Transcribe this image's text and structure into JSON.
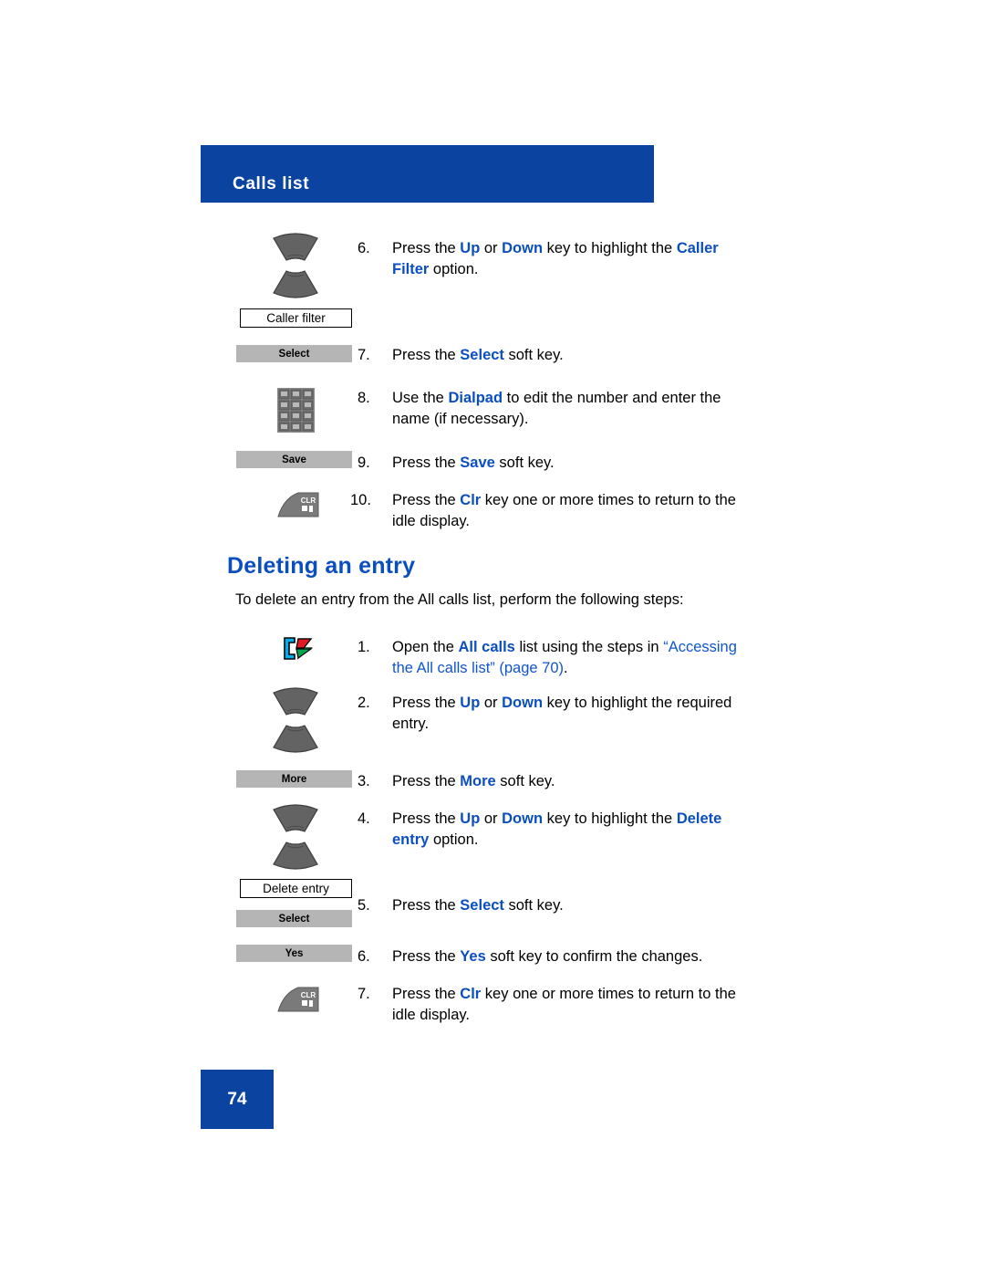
{
  "header": {
    "title": "Calls list"
  },
  "page": {
    "number": "74"
  },
  "section": {
    "heading": "Deleting an entry",
    "intro": "To delete an entry from the All calls list, perform the following steps:"
  },
  "icons": {
    "nav_keys": "up-down-navigation-keys-icon",
    "dialpad": "dialpad-icon",
    "clr_key": "clr-key-icon",
    "all_calls": "all-calls-icon",
    "clr_label": "CLR"
  },
  "labels": {
    "caller_filter": "Caller filter",
    "delete_entry": "Delete entry"
  },
  "softkeys": {
    "select_1": "Select",
    "save": "Save",
    "more": "More",
    "select_2": "Select",
    "yes": "Yes"
  },
  "steps_top": [
    {
      "num": "6.",
      "parts": [
        {
          "t": "Press the ",
          "s": "plain"
        },
        {
          "t": "Up",
          "s": "bold-blue"
        },
        {
          "t": " or ",
          "s": "plain"
        },
        {
          "t": "Down",
          "s": "bold-blue"
        },
        {
          "t": " key to highlight the ",
          "s": "plain"
        },
        {
          "t": "Caller Filter",
          "s": "bold-blue"
        },
        {
          "t": " option.",
          "s": "plain"
        }
      ]
    },
    {
      "num": "7.",
      "parts": [
        {
          "t": "Press the ",
          "s": "plain"
        },
        {
          "t": "Select",
          "s": "bold-blue"
        },
        {
          "t": " soft key.",
          "s": "plain"
        }
      ]
    },
    {
      "num": "8.",
      "parts": [
        {
          "t": "Use the ",
          "s": "plain"
        },
        {
          "t": "Dialpad",
          "s": "bold-blue"
        },
        {
          "t": " to edit the number and enter the name (if necessary).",
          "s": "plain"
        }
      ]
    },
    {
      "num": "9.",
      "parts": [
        {
          "t": "Press the ",
          "s": "plain"
        },
        {
          "t": "Save",
          "s": "bold-blue"
        },
        {
          "t": " soft key.",
          "s": "plain"
        }
      ]
    },
    {
      "num": "10.",
      "parts": [
        {
          "t": "Press the ",
          "s": "plain"
        },
        {
          "t": "Clr",
          "s": "bold-blue"
        },
        {
          "t": " key one or more times to return to the idle display.",
          "s": "plain"
        }
      ]
    }
  ],
  "steps_bottom": [
    {
      "num": "1.",
      "parts": [
        {
          "t": "Open the ",
          "s": "plain"
        },
        {
          "t": "All calls",
          "s": "bold-blue"
        },
        {
          "t": " list using the steps in ",
          "s": "plain"
        },
        {
          "t": "“Accessing the All calls list” (page 70)",
          "s": "link"
        },
        {
          "t": ".",
          "s": "plain"
        }
      ]
    },
    {
      "num": "2.",
      "parts": [
        {
          "t": "Press the ",
          "s": "plain"
        },
        {
          "t": "Up",
          "s": "bold-blue"
        },
        {
          "t": " or ",
          "s": "plain"
        },
        {
          "t": "Down",
          "s": "bold-blue"
        },
        {
          "t": " key to highlight the required entry.",
          "s": "plain"
        }
      ]
    },
    {
      "num": "3.",
      "parts": [
        {
          "t": "Press the ",
          "s": "plain"
        },
        {
          "t": "More",
          "s": "bold-blue"
        },
        {
          "t": " soft key.",
          "s": "plain"
        }
      ]
    },
    {
      "num": "4.",
      "parts": [
        {
          "t": "Press the ",
          "s": "plain"
        },
        {
          "t": "Up",
          "s": "bold-blue"
        },
        {
          "t": " or ",
          "s": "plain"
        },
        {
          "t": "Down",
          "s": "bold-blue"
        },
        {
          "t": " key to highlight the ",
          "s": "plain"
        },
        {
          "t": "Delete entry",
          "s": "bold-blue"
        },
        {
          "t": " option.",
          "s": "plain"
        }
      ]
    },
    {
      "num": "5.",
      "parts": [
        {
          "t": "Press the ",
          "s": "plain"
        },
        {
          "t": "Select",
          "s": "bold-blue"
        },
        {
          "t": " soft key.",
          "s": "plain"
        }
      ]
    },
    {
      "num": "6.",
      "parts": [
        {
          "t": "Press the ",
          "s": "plain"
        },
        {
          "t": "Yes",
          "s": "bold-blue"
        },
        {
          "t": " soft key to confirm the changes.",
          "s": "plain"
        }
      ]
    },
    {
      "num": "7.",
      "parts": [
        {
          "t": "Press the ",
          "s": "plain"
        },
        {
          "t": "Clr",
          "s": "bold-blue"
        },
        {
          "t": " key one or more times to return to the idle display.",
          "s": "plain"
        }
      ]
    }
  ],
  "colors": {
    "header_blue": "#0B44A0",
    "emphasis_blue": "#0B4FBF",
    "link_blue": "#1155CC",
    "softkey_gray": "#B5B5B5"
  }
}
